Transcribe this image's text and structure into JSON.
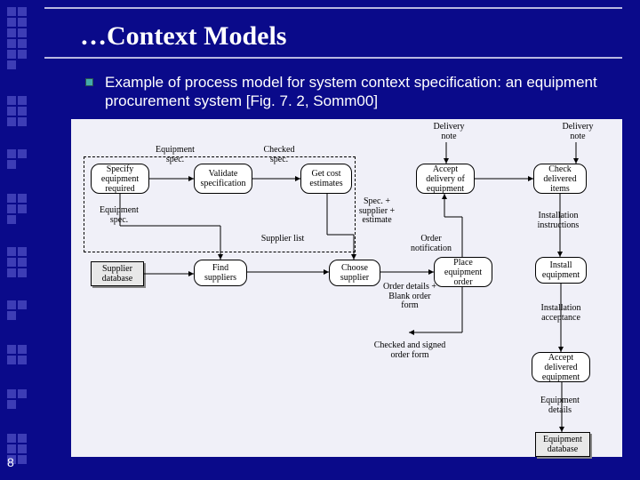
{
  "slide": {
    "title": "…Context Models",
    "bullet_text": "Example of process model for system context specification: an equipment procurement system [Fig. 7. 2, Somm00]",
    "page_number": "8"
  },
  "diagram": {
    "boxes": {
      "specify": "Specify equipment required",
      "validate": "Validate specification",
      "get_cost": "Get cost estimates",
      "accept_delivery": "Accept delivery of equipment",
      "check_items": "Check delivered items",
      "supplier_db": "Supplier database",
      "find_suppliers": "Find suppliers",
      "choose_supplier": "Choose supplier",
      "place_order": "Place equipment order",
      "install": "Install equipment",
      "accept_equipment": "Accept delivered equipment",
      "equipment_db": "Equipment database"
    },
    "labels": {
      "delivery_note_top": "Delivery note",
      "delivery_note_right": "Delivery note",
      "equipment_spec": "Equipment spec.",
      "checked_spec": "Checked spec.",
      "spec_supplier_estimate": "Spec. + supplier + estimate",
      "order_notification": "Order notification",
      "installation_instructions": "Installation instructions",
      "equipment_spec2": "Equipment spec.",
      "supplier_list": "Supplier list",
      "order_details_blank": "Order details + Blank order form",
      "checked_signed": "Checked and signed order form",
      "installation_acceptance": "Installation acceptance",
      "equipment_details": "Equipment details"
    }
  }
}
